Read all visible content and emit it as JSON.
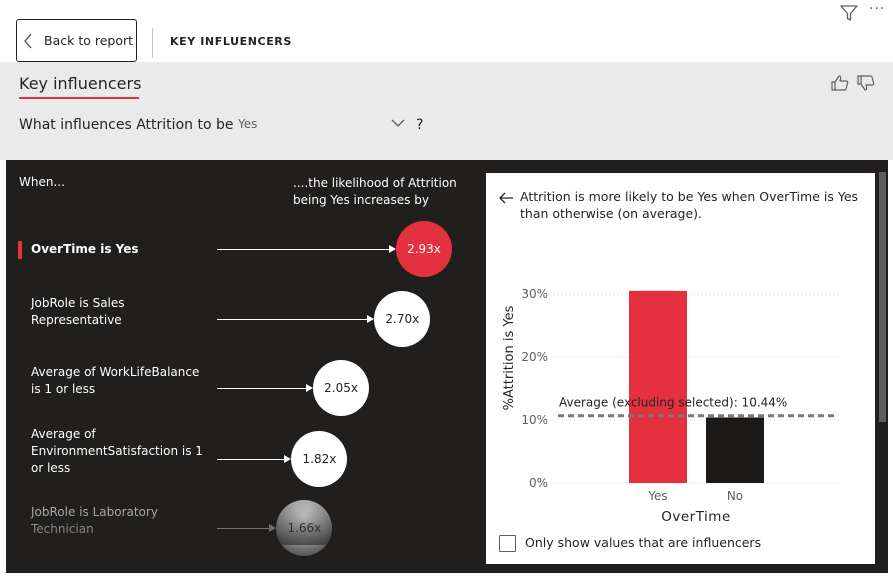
{
  "header": {
    "back_label": "Back to report",
    "page_name": "KEY INFLUENCERS",
    "more_glyph": "···"
  },
  "visual": {
    "title": "Key influencers",
    "question": "What influences Attrition to be",
    "target_value": "Yes",
    "help": "?"
  },
  "influencers": {
    "col_when": "When...",
    "col_likelihood": "....the likelihood of Attrition being Yes increases by",
    "items": [
      {
        "label": "OverTime is Yes",
        "value": "2.93x",
        "multiplier": 2.93,
        "selected": true
      },
      {
        "label": "JobRole is Sales Representative",
        "value": "2.70x",
        "multiplier": 2.7,
        "selected": false
      },
      {
        "label": "Average of WorkLifeBalance is 1 or less",
        "value": "2.05x",
        "multiplier": 2.05,
        "selected": false
      },
      {
        "label": "Average of EnvironmentSatisfaction is 1 or less",
        "value": "1.82x",
        "multiplier": 1.82,
        "selected": false
      },
      {
        "label": "JobRole is Laboratory Technician",
        "value": "1.66x",
        "multiplier": 1.66,
        "selected": false
      }
    ]
  },
  "detail": {
    "description": "Attrition is more likely to be Yes when OverTime is Yes than otherwise (on average).",
    "checkbox_label": "Only show values that are influencers"
  },
  "colors": {
    "accent": "#e5303f",
    "dark_bg": "#201f1e",
    "bar_other": "#1b1a19",
    "gray_bg": "#eaeaea"
  },
  "chart_data": {
    "type": "bar",
    "categories": [
      "Yes",
      "No"
    ],
    "values": [
      30.5,
      10.4
    ],
    "ylabel": "%Attrition is Yes",
    "xlabel": "OverTime",
    "ylim": [
      0,
      30
    ],
    "yticks": [
      "0%",
      "10%",
      "20%",
      "30%"
    ],
    "reference_line": {
      "label": "Average (excluding selected): 10.44%",
      "value": 10.44
    },
    "bar_colors": [
      "#e5303f",
      "#1b1a19"
    ],
    "grid": true
  }
}
